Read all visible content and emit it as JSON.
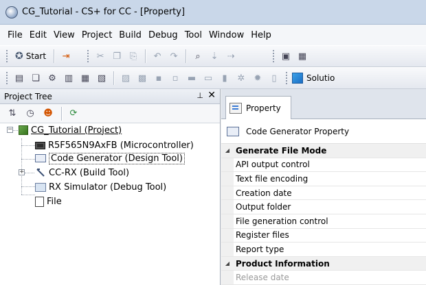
{
  "window": {
    "title": "CG_Tutorial - CS+ for CC - [Property]"
  },
  "menu": [
    "File",
    "Edit",
    "View",
    "Project",
    "Build",
    "Debug",
    "Tool",
    "Window",
    "Help"
  ],
  "toolbar": {
    "start_label": "Start",
    "solution_label": "Solutio"
  },
  "project_tree": {
    "title": "Project Tree",
    "nodes": [
      {
        "label": "CG_Tutorial (Project)",
        "icon": "project-icon"
      },
      {
        "label": "R5F565N9AxFB (Microcontroller)",
        "icon": "microcontroller-icon"
      },
      {
        "label": "Code Generator (Design Tool)",
        "icon": "code-generator-icon"
      },
      {
        "label": "CC-RX (Build Tool)",
        "icon": "build-tool-icon"
      },
      {
        "label": "RX Simulator (Debug Tool)",
        "icon": "simulator-icon"
      },
      {
        "label": "File",
        "icon": "file-icon"
      }
    ]
  },
  "property_panel": {
    "tab_label": "Property",
    "header": "Code Generator Property",
    "rows": [
      {
        "label": "Generate File Mode",
        "type": "category"
      },
      {
        "label": "API output control",
        "type": "item"
      },
      {
        "label": "Text file encoding",
        "type": "item"
      },
      {
        "label": "Creation date",
        "type": "item"
      },
      {
        "label": "Output folder",
        "type": "item"
      },
      {
        "label": "File generation control",
        "type": "item"
      },
      {
        "label": "Register files",
        "type": "item"
      },
      {
        "label": "Report type",
        "type": "item"
      },
      {
        "label": "Product Information",
        "type": "category"
      },
      {
        "label": "Release date",
        "type": "dimmed"
      }
    ]
  }
}
